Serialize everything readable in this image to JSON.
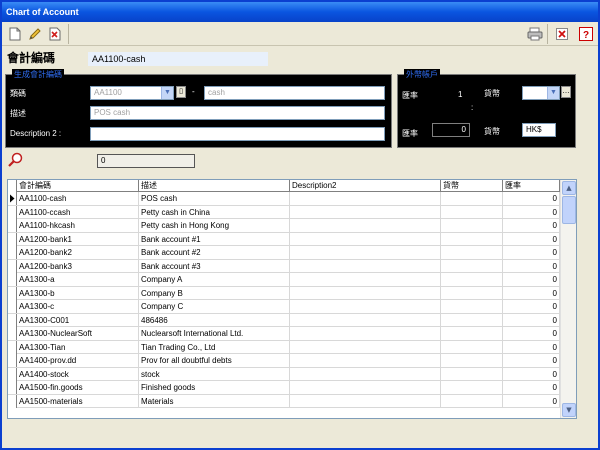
{
  "window": {
    "title": "Chart of Account"
  },
  "toolbar": {
    "new_icon": "new-document-icon",
    "edit_icon": "pencil-icon",
    "delete_icon": "delete-icon",
    "print_icon": "print-icon",
    "close_icon": "close-icon",
    "help_icon": "help-icon",
    "help_glyph": "?"
  },
  "header": {
    "account_code_label": "會計編碼",
    "account_code_value": "AA1100-cash"
  },
  "generate_panel": {
    "title": "生成會計編碼",
    "type_label": "類碼",
    "type_value": "AA1100",
    "separator": "-",
    "suffix_value": "cash",
    "description_label": "描述",
    "description_value": "POS cash",
    "description2_label": "Description 2 :",
    "description2_value": ""
  },
  "currency_panel": {
    "title": "外幣帳戶",
    "rate_label_1": "匯率",
    "rate_value_1": "1",
    "currency_label_1": "貨幣",
    "currency_value_1": "",
    "colon": ":",
    "rate_label_2": "匯率",
    "rate_value_2": "0",
    "currency_label_2": "貨幣",
    "currency_value_2": "HK$"
  },
  "search": {
    "icon": "search-icon",
    "value": "0"
  },
  "grid": {
    "columns": [
      "會計編碼",
      "描述",
      "Description2",
      "貨幣",
      "匯率"
    ],
    "rows": [
      [
        "AA1100-cash",
        "POS cash",
        "",
        "",
        "0"
      ],
      [
        "AA1100-ccash",
        "Petty cash in China",
        "",
        "",
        "0"
      ],
      [
        "AA1100-hkcash",
        "Petty cash in Hong Kong",
        "",
        "",
        "0"
      ],
      [
        "AA1200-bank1",
        "Bank account #1",
        "",
        "",
        "0"
      ],
      [
        "AA1200-bank2",
        "Bank account #2",
        "",
        "",
        "0"
      ],
      [
        "AA1200-bank3",
        "Bank account #3",
        "",
        "",
        "0"
      ],
      [
        "AA1300-a",
        "Company A",
        "",
        "",
        "0"
      ],
      [
        "AA1300-b",
        "Company B",
        "",
        "",
        "0"
      ],
      [
        "AA1300-c",
        "Company C",
        "",
        "",
        "0"
      ],
      [
        "AA1300-C001",
        "486486",
        "",
        "",
        "0"
      ],
      [
        "AA1300-NuclearSoft",
        "Nuclearsoft International Ltd.",
        "",
        "",
        "0"
      ],
      [
        "AA1300-Tian",
        "Tian Trading Co., Ltd",
        "",
        "",
        "0"
      ],
      [
        "AA1400-prov.dd",
        "Prov for all doubtful debts",
        "",
        "",
        "0"
      ],
      [
        "AA1400-stock",
        "stock",
        "",
        "",
        "0"
      ],
      [
        "AA1500-fin.goods",
        "Finished goods",
        "",
        "",
        "0"
      ],
      [
        "AA1500-materials",
        "Materials",
        "",
        "",
        "0"
      ]
    ]
  }
}
